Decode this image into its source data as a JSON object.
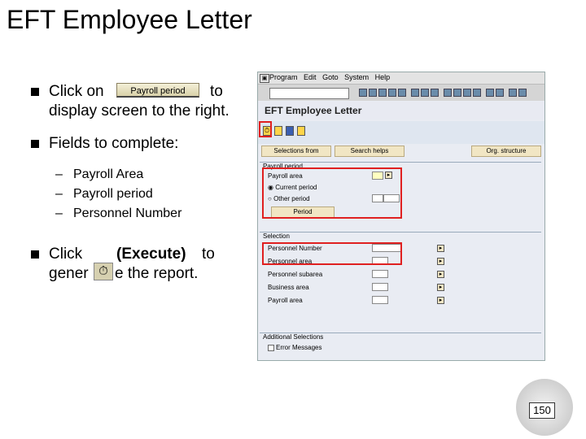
{
  "title": "EFT Employee Letter",
  "bullets": {
    "b1_prefix": "Click on",
    "b1_button": "Payroll period",
    "b1_suffix": "to",
    "b1_line2": "display screen to the right.",
    "b2": "Fields to complete:",
    "b2_items": [
      "Payroll Area",
      "Payroll period",
      "Personnel Number"
    ],
    "b3_line1_prefix": "Click",
    "b3_exec": "(Execute)",
    "b3_line1_suffix": "to",
    "b3_line2_a": "gener",
    "b3_line2_b": "e the report."
  },
  "sap": {
    "menu": [
      "Program",
      "Edit",
      "Goto",
      "System",
      "Help"
    ],
    "window_title": "EFT Employee Letter",
    "buttons": {
      "selections_from": "Selections from",
      "search_helps": "Search helps",
      "org_structure": "Org. structure",
      "period": "Period"
    },
    "period_group": {
      "label": "Payroll period",
      "payroll_area": "Payroll area",
      "current_period": "Current period",
      "other_period": "Other period"
    },
    "selection_group": {
      "label": "Selection",
      "fields": [
        "Personnel Number",
        "Personnel area",
        "Personnel subarea",
        "Business area",
        "Payroll area"
      ]
    },
    "additional_group": {
      "label": "Additional Selections",
      "error_messages": "Error Messages"
    }
  },
  "page_number": "150"
}
